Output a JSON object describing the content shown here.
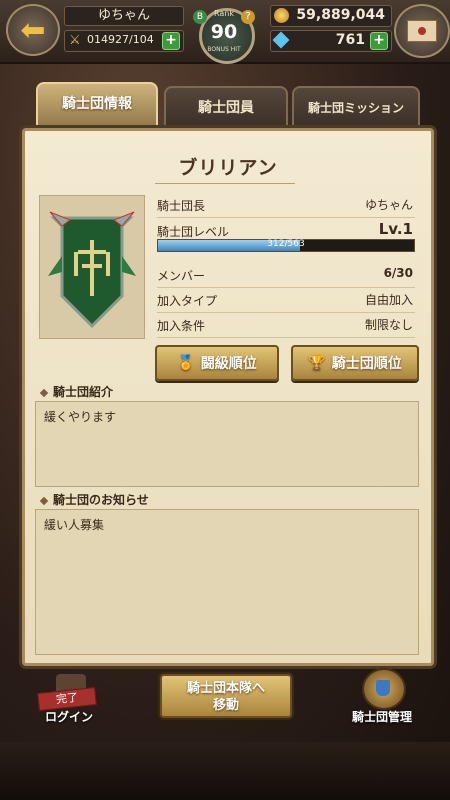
{
  "header": {
    "player_name": "ゆちゃん",
    "stamina": "014927/104",
    "rank_label": "Rank",
    "rank_value": "90",
    "rank_bonus": "BONUS HIT",
    "gold": "59,889,044",
    "gems": "761"
  },
  "tabs": [
    {
      "label": "騎士団情報",
      "active": true
    },
    {
      "label": "騎士団員",
      "active": false
    },
    {
      "label": "騎士団ミッション",
      "active": false
    }
  ],
  "guild": {
    "name": "ブリリアン",
    "leader_label": "騎士団長",
    "leader_value": "ゆちゃん",
    "level_label": "騎士団レベル",
    "level_value": "Lv.1",
    "exp_text": "312/563",
    "exp_fraction": 0.554,
    "members_label": "メンバー",
    "members_value": "6/30",
    "join_type_label": "加入タイプ",
    "join_type_value": "自由加入",
    "join_cond_label": "加入条件",
    "join_cond_value": "制限なし"
  },
  "buttons": {
    "rank_class": "闘級順位",
    "rank_guild": "騎士団順位",
    "move_line1": "騎士団本隊へ",
    "move_line2": "移動",
    "login_done": "完了",
    "login_label": "ログイン",
    "manage_label": "騎士団管理"
  },
  "sections": {
    "intro_header": "騎士団紹介",
    "intro_text": "緩くやります",
    "notice_header": "騎士団のお知らせ",
    "notice_text": "緩い人募集"
  },
  "colors": {
    "accent_gold": "#c9a75c",
    "parchment": "#f3ead2",
    "exp_bar": "#3f86c0"
  }
}
